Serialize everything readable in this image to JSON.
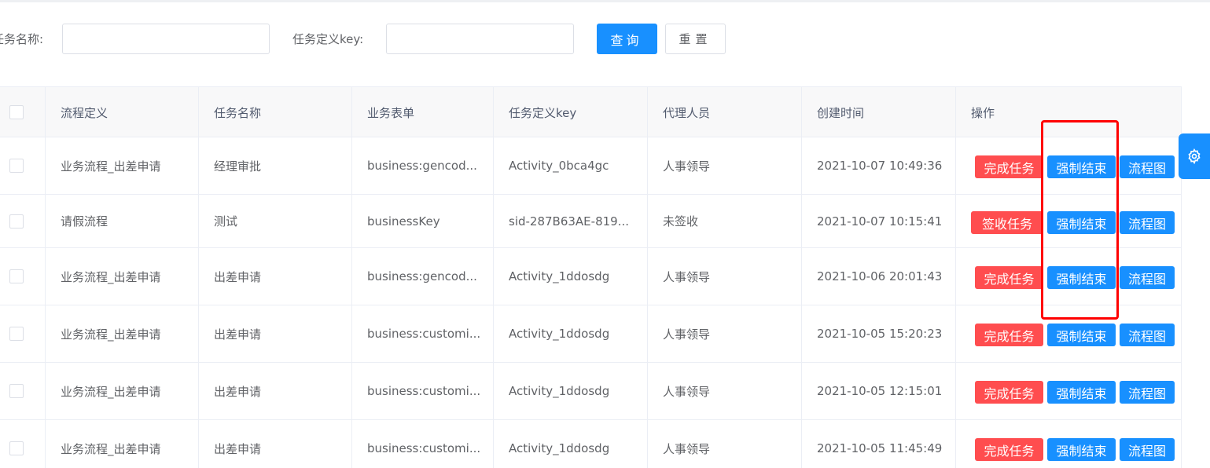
{
  "search": {
    "task_name_label": "任务名称:",
    "task_name_value": "",
    "task_key_label": "任务定义key:",
    "task_key_value": "",
    "query_label": "查询",
    "reset_label": "重置"
  },
  "table": {
    "headers": [
      "流程定义",
      "任务名称",
      "业务表单",
      "任务定义key",
      "代理人员",
      "创建时间",
      "操作"
    ],
    "rows": [
      {
        "process": "业务流程_出差申请",
        "task": "经理审批",
        "form": "business:gencod...",
        "key": "Activity_0bca4gc",
        "agent": "人事领导",
        "time": "2021-10-07 10:49:36",
        "op1": "完成任务",
        "op2": "强制结束",
        "op3": "流程图"
      },
      {
        "process": "请假流程",
        "task": "测试",
        "form": "businessKey",
        "key": "sid-287B63AE-819...",
        "agent": "未签收",
        "time": "2021-10-07 10:15:41",
        "op1": "签收任务",
        "op2": "强制结束",
        "op3": "流程图"
      },
      {
        "process": "业务流程_出差申请",
        "task": "出差申请",
        "form": "business:gencod...",
        "key": "Activity_1ddosdg",
        "agent": "人事领导",
        "time": "2021-10-06 20:01:43",
        "op1": "完成任务",
        "op2": "强制结束",
        "op3": "流程图"
      },
      {
        "process": "业务流程_出差申请",
        "task": "出差申请",
        "form": "business:customi...",
        "key": "Activity_1ddosdg",
        "agent": "人事领导",
        "time": "2021-10-05 15:20:23",
        "op1": "完成任务",
        "op2": "强制结束",
        "op3": "流程图"
      },
      {
        "process": "业务流程_出差申请",
        "task": "出差申请",
        "form": "business:customi...",
        "key": "Activity_1ddosdg",
        "agent": "人事领导",
        "time": "2021-10-05 12:15:01",
        "op1": "完成任务",
        "op2": "强制结束",
        "op3": "流程图"
      },
      {
        "process": "业务流程_出差申请",
        "task": "出差申请",
        "form": "business:customi...",
        "key": "Activity_1ddosdg",
        "agent": "人事领导",
        "time": "2021-10-05 11:45:49",
        "op1": "完成任务",
        "op2": "强制结束",
        "op3": "流程图"
      }
    ]
  },
  "settings": {
    "icon": "gear-icon"
  },
  "colors": {
    "primary": "#1890ff",
    "danger": "#ff4d4f",
    "highlight": "#ff0000"
  }
}
